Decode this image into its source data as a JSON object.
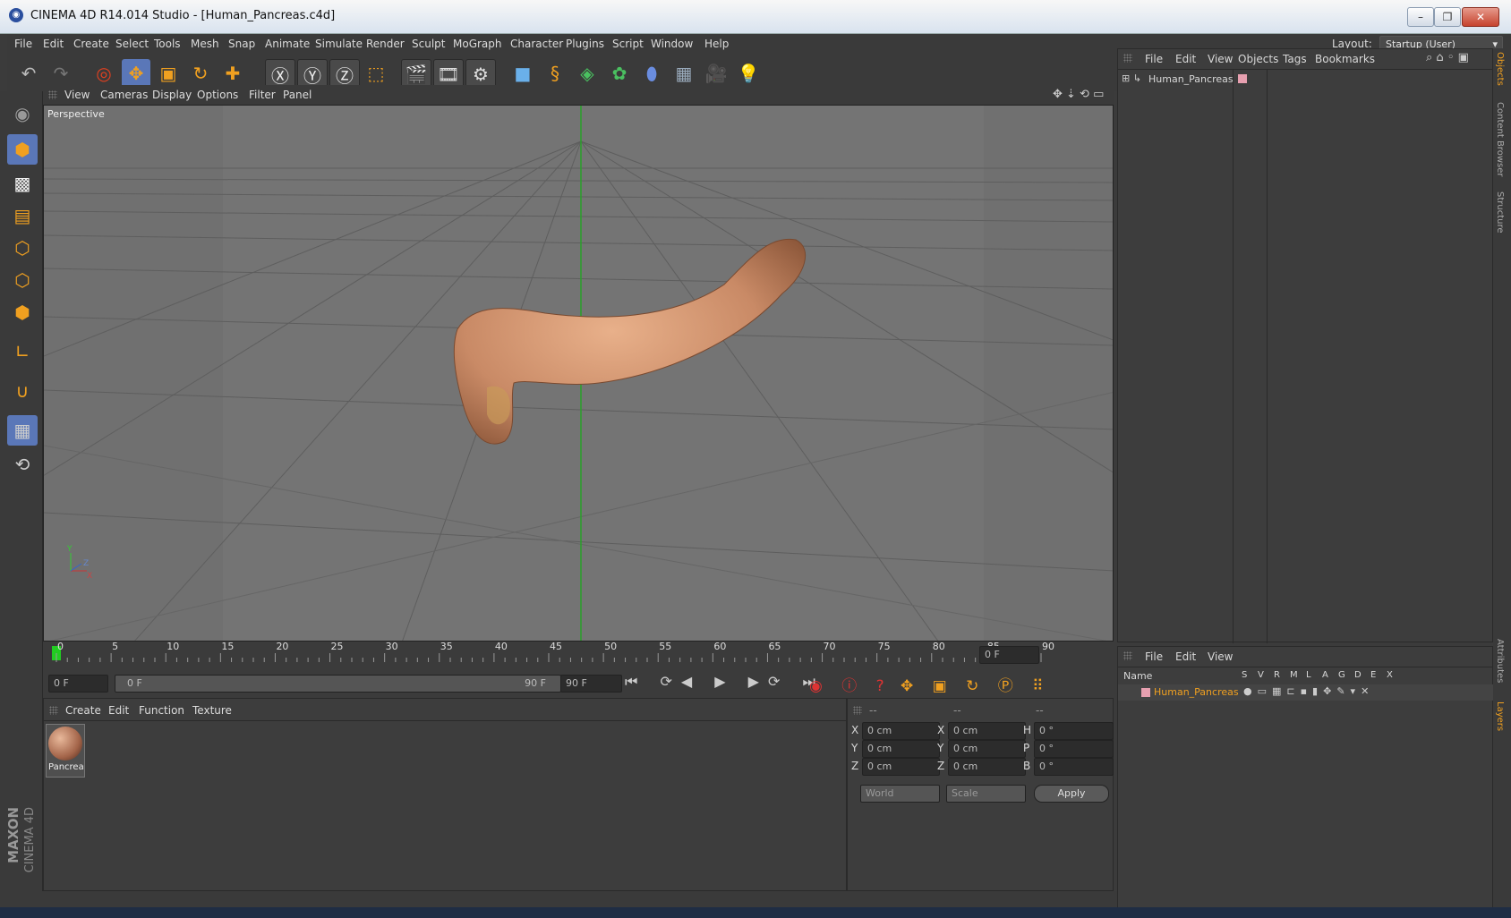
{
  "window": {
    "title": "CINEMA 4D R14.014 Studio - [Human_Pancreas.c4d]",
    "controls": [
      "–",
      "❐",
      "✕"
    ]
  },
  "menubar": {
    "items": [
      "File",
      "Edit",
      "Create",
      "Select",
      "Tools",
      "Mesh",
      "Snap",
      "Animate",
      "Simulate",
      "Render",
      "Sculpt",
      "MoGraph",
      "Character",
      "Plugins",
      "Script",
      "Window",
      "Help"
    ],
    "layout_label": "Layout:",
    "layout_value": "Startup (User)"
  },
  "viewport": {
    "menu": [
      "View",
      "Cameras",
      "Display",
      "Options",
      "Filter",
      "Panel"
    ],
    "label": "Perspective",
    "axis_y": "Y",
    "axis_z": "Z",
    "axis_x": "X"
  },
  "timeline": {
    "ticks": [
      "0",
      "5",
      "10",
      "15",
      "20",
      "25",
      "30",
      "35",
      "40",
      "45",
      "50",
      "55",
      "60",
      "65",
      "70",
      "75",
      "80",
      "85",
      "90"
    ],
    "current_frame": "0 F",
    "start_field": "0 F",
    "range_start": "0 F",
    "range_end": "90 F",
    "end_field": "90 F"
  },
  "materials": {
    "menu": [
      "Create",
      "Edit",
      "Function",
      "Texture"
    ],
    "items": [
      {
        "name": "Pancrea"
      }
    ]
  },
  "coordinates": {
    "headers": [
      "--",
      "--",
      "--"
    ],
    "rows": [
      {
        "a": "X",
        "av": "0 cm",
        "b": "X",
        "bv": "0 cm",
        "c": "H",
        "cv": "0 °"
      },
      {
        "a": "Y",
        "av": "0 cm",
        "b": "Y",
        "bv": "0 cm",
        "c": "P",
        "cv": "0 °"
      },
      {
        "a": "Z",
        "av": "0 cm",
        "b": "Z",
        "bv": "0 cm",
        "c": "B",
        "cv": "0 °"
      }
    ],
    "mode_world": "World",
    "mode_scale": "Scale",
    "apply": "Apply"
  },
  "objects": {
    "menu": [
      "File",
      "Edit",
      "View",
      "Objects",
      "Tags",
      "Bookmarks"
    ],
    "items": [
      {
        "name": "Human_Pancreas"
      }
    ]
  },
  "layers": {
    "menu": [
      "File",
      "Edit",
      "View"
    ],
    "col_name": "Name",
    "cols": [
      "S",
      "V",
      "R",
      "M",
      "L",
      "A",
      "G",
      "D",
      "E",
      "X"
    ],
    "items": [
      {
        "name": "Human_Pancreas"
      }
    ]
  },
  "right_tabs": [
    "Objects",
    "Content Browser",
    "Structure",
    "Attributes",
    "Layers"
  ],
  "brand": {
    "line1": "MAXON",
    "line2": "CINEMA 4D"
  },
  "colors": {
    "accent": "#5a77b8",
    "highlight": "#f0a020",
    "layer_name": "#f0a020"
  }
}
